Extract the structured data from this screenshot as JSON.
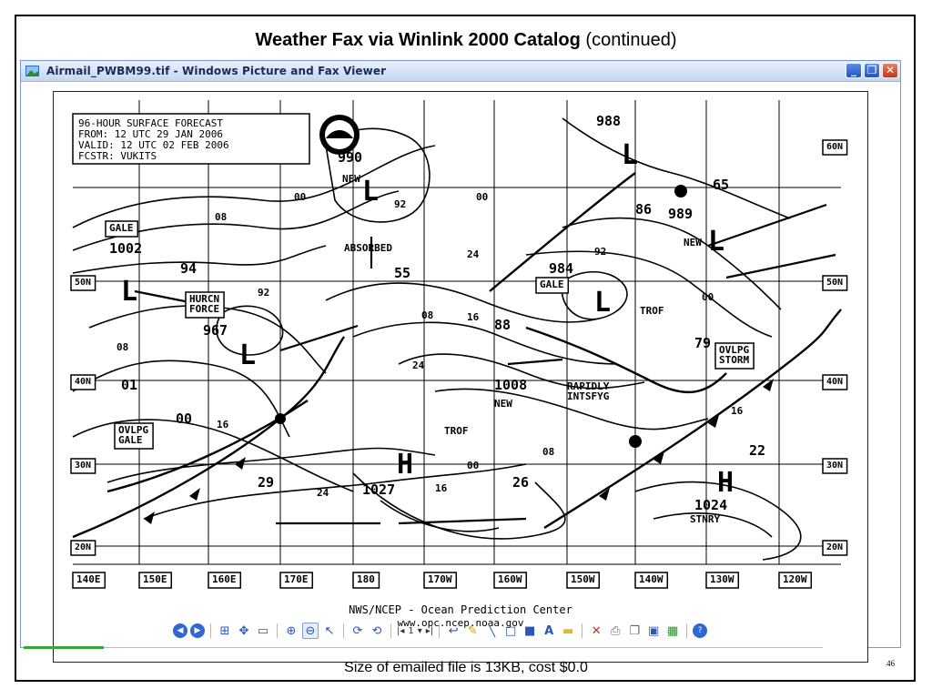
{
  "slide": {
    "title_bold": "Weather Fax via Winlink 2000 Catalog",
    "title_rest": "(continued)",
    "caption": "Size of emailed file is 13KB, cost  $0.0",
    "page_number": "46"
  },
  "window": {
    "title": "Airmail_PWBM99.tif - Windows Picture and Fax Viewer",
    "minimize": "_",
    "maximize": "❐",
    "close": "✕"
  },
  "map": {
    "header_lines": [
      "96-HOUR SURFACE FORECAST",
      "FROM:  12 UTC 29 JAN 2006",
      "VALID: 12 UTC 02 FEB 2006",
      "FCSTR: VUKITS"
    ],
    "footer_1": "NWS/NCEP - Ocean Prediction Center",
    "footer_2": "www.opc.ncep.noaa.gov",
    "longitudes": [
      "140E",
      "150E",
      "160E",
      "170E",
      "180",
      "170W",
      "160W",
      "150W",
      "140W",
      "130W",
      "120W"
    ],
    "latitudes_right": [
      "60N",
      "50N",
      "40N",
      "30N",
      "20N"
    ],
    "latitudes_left": [
      "50N",
      "40N",
      "30N",
      "20N"
    ],
    "boxed_labels": [
      "GALE",
      "HURCN\nFORCE",
      "OVLPG\nGALE",
      "GALE",
      "OVLPG\nSTORM"
    ],
    "pressure_numbers": [
      "990",
      "988",
      "1002",
      "94",
      "967",
      "55",
      "984",
      "86",
      "989",
      "65",
      "88",
      "79",
      "1008",
      "01",
      "00",
      "29",
      "1027",
      "26",
      "1024",
      "22"
    ],
    "contour_labels": [
      "00",
      "08",
      "92",
      "00",
      "08",
      "92",
      "16",
      "24",
      "24",
      "16",
      "08",
      "00",
      "92",
      "16",
      "08",
      "16",
      "00",
      "24"
    ],
    "text_labels": [
      "NEW",
      "ABSORBED",
      "NEW",
      "NEW",
      "TROF",
      "TROF",
      "RAPIDLY\nINTSFYG",
      "STNRY"
    ],
    "symbols": [
      "L",
      "L",
      "L",
      "L",
      "L",
      "L",
      "H",
      "H"
    ]
  },
  "toolbar": {
    "icons": [
      "previous-image-icon",
      "next-image-icon",
      "best-fit-icon",
      "actual-size-icon",
      "slideshow-icon",
      "zoom-in-icon",
      "zoom-out-icon",
      "select-icon",
      "rotate-clockwise-icon",
      "rotate-counterclockwise-icon",
      "first-page-icon",
      "page-dropdown",
      "last-page-icon",
      "annotation-icon",
      "pen-icon",
      "line-icon",
      "rectangle-icon",
      "filled-rectangle-icon",
      "text-icon",
      "note-icon",
      "delete-icon",
      "print-icon",
      "copy-icon",
      "save-icon",
      "edit-icon",
      "help-icon"
    ],
    "page_value": "1",
    "page_dropdown": "▾"
  }
}
